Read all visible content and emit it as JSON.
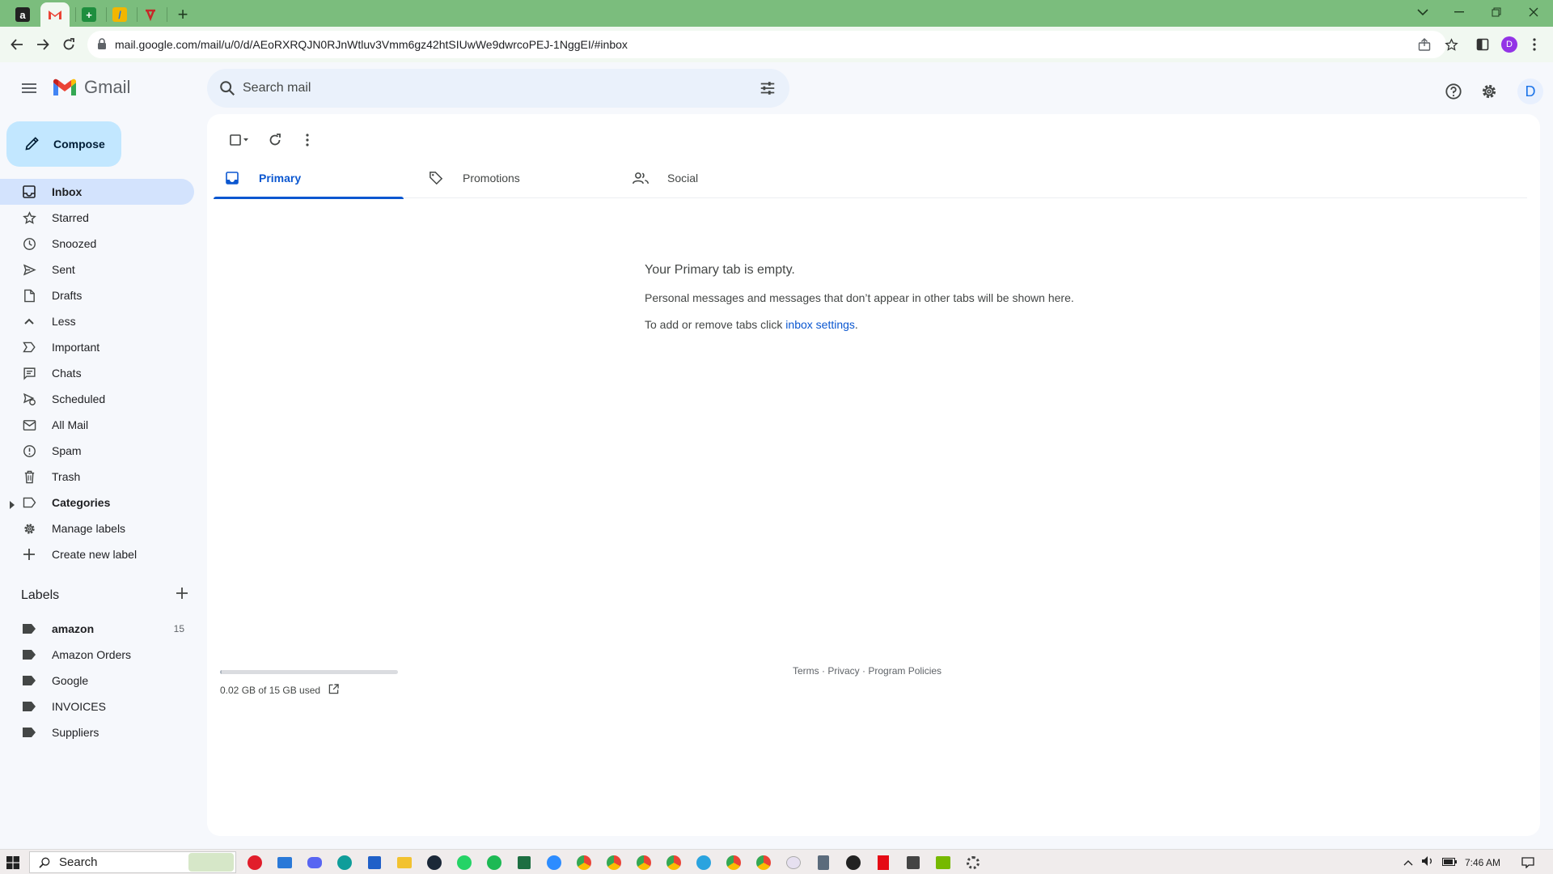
{
  "browser": {
    "url": "mail.google.com/mail/u/0/d/AEoRXRQJN0RJnWtluv3Vmm6gz42htSIUwWe9dwrcoPEJ-1NggEI/#inbox",
    "profile_initial": "D"
  },
  "header": {
    "logo_text": "Gmail",
    "search_placeholder": "Search mail",
    "account_initial": "D"
  },
  "sidebar": {
    "compose_label": "Compose",
    "items": [
      {
        "label": "Inbox",
        "icon": "inbox-icon",
        "active": true
      },
      {
        "label": "Starred",
        "icon": "star-icon"
      },
      {
        "label": "Snoozed",
        "icon": "clock-icon"
      },
      {
        "label": "Sent",
        "icon": "send-icon"
      },
      {
        "label": "Drafts",
        "icon": "draft-icon"
      },
      {
        "label": "Less",
        "icon": "chevron-up-icon"
      },
      {
        "label": "Important",
        "icon": "important-icon"
      },
      {
        "label": "Chats",
        "icon": "chat-icon"
      },
      {
        "label": "Scheduled",
        "icon": "scheduled-icon"
      },
      {
        "label": "All Mail",
        "icon": "all-mail-icon"
      },
      {
        "label": "Spam",
        "icon": "spam-icon"
      },
      {
        "label": "Trash",
        "icon": "trash-icon"
      },
      {
        "label": "Categories",
        "icon": "label-outline-icon",
        "bold": true
      },
      {
        "label": "Manage labels",
        "icon": "gear-icon"
      },
      {
        "label": "Create new label",
        "icon": "plus-icon"
      }
    ],
    "labels_heading": "Labels",
    "labels": [
      {
        "label": "amazon",
        "count": "15",
        "bold": true
      },
      {
        "label": "Amazon Orders"
      },
      {
        "label": "Google"
      },
      {
        "label": "INVOICES"
      },
      {
        "label": "Suppliers"
      }
    ]
  },
  "main": {
    "tabs": [
      {
        "label": "Primary",
        "icon": "inbox-tab-icon",
        "active": true
      },
      {
        "label": "Promotions",
        "icon": "tag-icon"
      },
      {
        "label": "Social",
        "icon": "people-icon"
      }
    ],
    "empty_title": "Your Primary tab is empty.",
    "empty_line1": "Personal messages and messages that don’t appear in other tabs will be shown here.",
    "empty_line2_prefix": "To add or remove tabs click ",
    "empty_line2_link": "inbox settings",
    "empty_line2_suffix": ".",
    "storage_text": "0.02 GB of 15 GB used",
    "storage_fraction": 0.0013,
    "footer_terms": "Terms",
    "footer_privacy": "Privacy",
    "footer_policies": "Program Policies",
    "footer_sep": " · "
  },
  "taskbar": {
    "search_label": "Search",
    "time": "7:46 AM"
  },
  "colors": {
    "tab_strip": "#7bbd7d",
    "active_nav": "#d3e3fd",
    "compose_bg": "#c2e7ff",
    "accent": "#0b57d0"
  }
}
